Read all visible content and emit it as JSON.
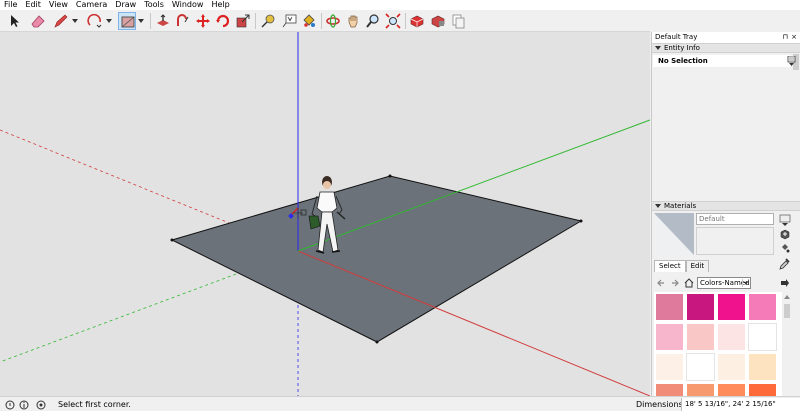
{
  "menu": [
    {
      "name": "menu-file",
      "label": "File"
    },
    {
      "name": "menu-edit",
      "label": "Edit"
    },
    {
      "name": "menu-view",
      "label": "View"
    },
    {
      "name": "menu-camera",
      "label": "Camera"
    },
    {
      "name": "menu-draw",
      "label": "Draw"
    },
    {
      "name": "menu-tools",
      "label": "Tools"
    },
    {
      "name": "menu-window",
      "label": "Window"
    },
    {
      "name": "menu-help",
      "label": "Help"
    }
  ],
  "tray": {
    "title": "Default Tray",
    "pin_glyph": "⊓",
    "close_glyph": "×",
    "entity_info": {
      "header": "Entity Info",
      "selection": "No Selection"
    },
    "materials": {
      "header": "Materials",
      "material_name": "Default",
      "tabs": [
        {
          "name": "tab-select",
          "label": "Select"
        },
        {
          "name": "tab-edit",
          "label": "Edit"
        }
      ],
      "collection": "Colors-Named",
      "swatch_colors": [
        "#e07a9c",
        "#c8177f",
        "#f0118d",
        "#f57bb8",
        "#f7b6cc",
        "#fac7c7",
        "#fce4e4",
        "#ffffff",
        "#fdf0e6",
        "#ffffff",
        "#fdf0e3",
        "#fde3c0",
        "#f08c78",
        "#f89a70",
        "#ff8c5a",
        "#ff6a3a"
      ]
    }
  },
  "status": {
    "message": "Select first corner.",
    "measurement_label": "Dimensions",
    "measurement_value": "18' 5 13/16\", 24' 2 15/16\""
  },
  "colors": {
    "viewport_bg": "#e2e2e2",
    "ground_plane": "#6b7279",
    "axis_blue": "#2a2af0",
    "axis_red": "#d23c3c",
    "axis_green": "#2fb82f",
    "active_tool": "#cce4f7"
  }
}
